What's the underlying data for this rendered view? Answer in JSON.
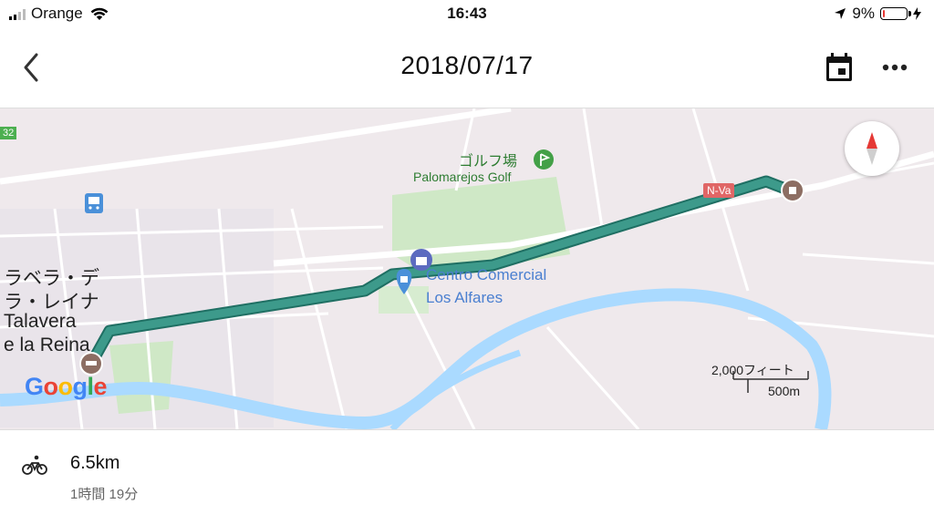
{
  "status_bar": {
    "carrier": "Orange",
    "time": "16:43",
    "battery_percent": "9%",
    "battery_level": 0.09,
    "battery_color": "#e53935"
  },
  "nav": {
    "title": "2018/07/17",
    "back_icon": "chevron-left-icon",
    "calendar_icon": "calendar-icon",
    "more_icon": "more-horizontal-icon"
  },
  "map": {
    "labels": {
      "golf_jp": "ゴルフ場",
      "golf": "Palomarejos Golf",
      "centro_line1": "Centro Comercial",
      "centro_line2": "Los Alfares",
      "city_line1": "ラベラ・デ",
      "city_line2": "ラ・レイナ",
      "city_line3": "Talavera",
      "city_line4": "e la Reina",
      "road": "N-Va",
      "road_number": "32"
    },
    "scale": {
      "feet": "2,000フィート",
      "meters": "500m"
    },
    "attribution": {
      "g1": "G",
      "o1": "o",
      "o2": "o",
      "g2": "g",
      "l": "l",
      "e": "e"
    },
    "route_color": "#3d9a8b",
    "river_color": "#aadaff",
    "park_color": "#c8e6c9"
  },
  "activity": {
    "icon": "bicycle-icon",
    "distance": "6.5km",
    "duration": "1時間 19分"
  }
}
